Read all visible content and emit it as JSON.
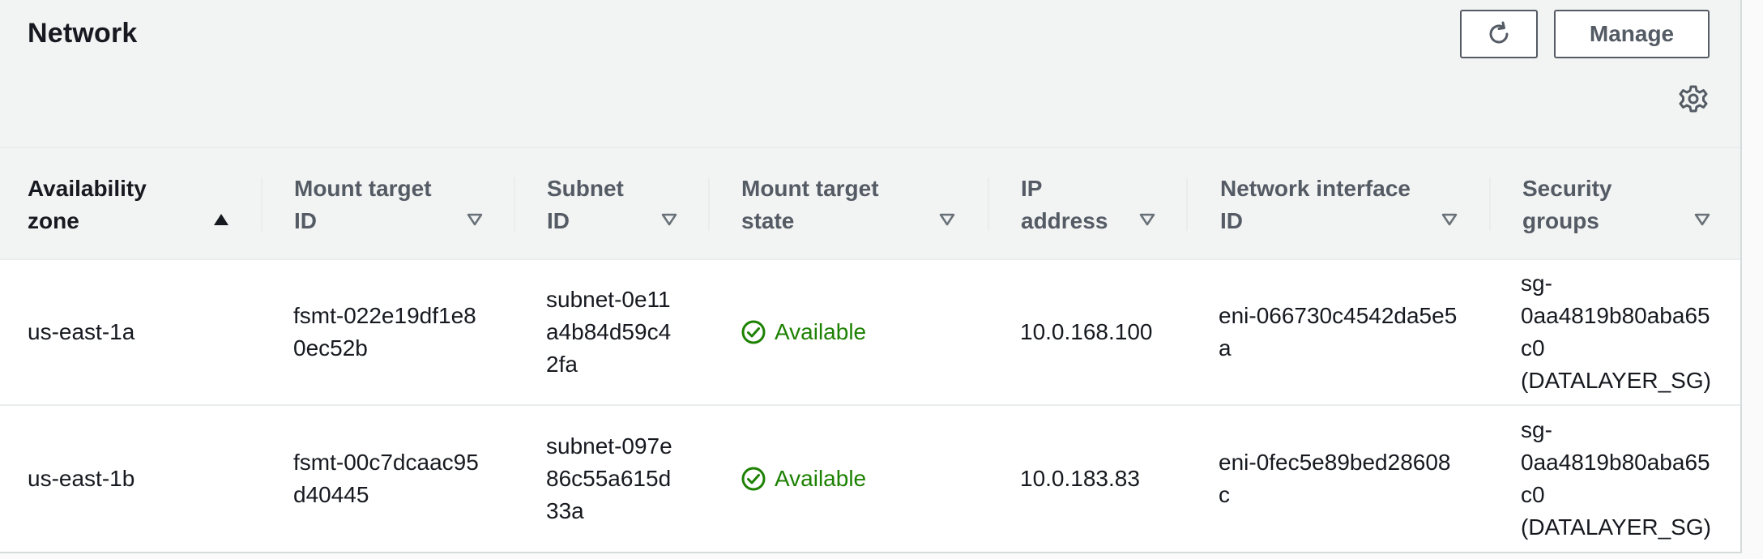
{
  "header": {
    "title": "Network",
    "manage_label": "Manage"
  },
  "icons": {
    "refresh": "refresh-icon",
    "settings": "gear-icon",
    "status_ok": "check-circle-icon",
    "sort_asc": "caret-up-filled-icon",
    "sort_none": "caret-down-outline-icon"
  },
  "colors": {
    "status_available": "#1d8102",
    "header_bg": "#f2f3f3",
    "button_border": "#545b64"
  },
  "table": {
    "columns": [
      {
        "label": "Availability zone",
        "sort": "ascending"
      },
      {
        "label": "Mount target ID",
        "sort": "none"
      },
      {
        "label": "Subnet ID",
        "sort": "none"
      },
      {
        "label": "Mount target state",
        "sort": "none"
      },
      {
        "label": "IP address",
        "sort": "none"
      },
      {
        "label": "Network interface ID",
        "sort": "none"
      },
      {
        "label": "Security groups",
        "sort": "none"
      }
    ],
    "rows": [
      {
        "availability_zone": "us-east-1a",
        "mount_target_id": "fsmt-022e19df1e80ec52b",
        "subnet_id": "subnet-0e11a4b84d59c42fa",
        "state": "Available",
        "ip_address": "10.0.168.100",
        "network_interface_id": "eni-066730c4542da5e5a",
        "security_groups": "sg-0aa4819b80aba65c0 (DATALAYER_SG)"
      },
      {
        "availability_zone": "us-east-1b",
        "mount_target_id": "fsmt-00c7dcaac95d40445",
        "subnet_id": "subnet-097e86c55a615d33a",
        "state": "Available",
        "ip_address": "10.0.183.83",
        "network_interface_id": "eni-0fec5e89bed28608c",
        "security_groups": "sg-0aa4819b80aba65c0 (DATALAYER_SG)"
      }
    ]
  }
}
